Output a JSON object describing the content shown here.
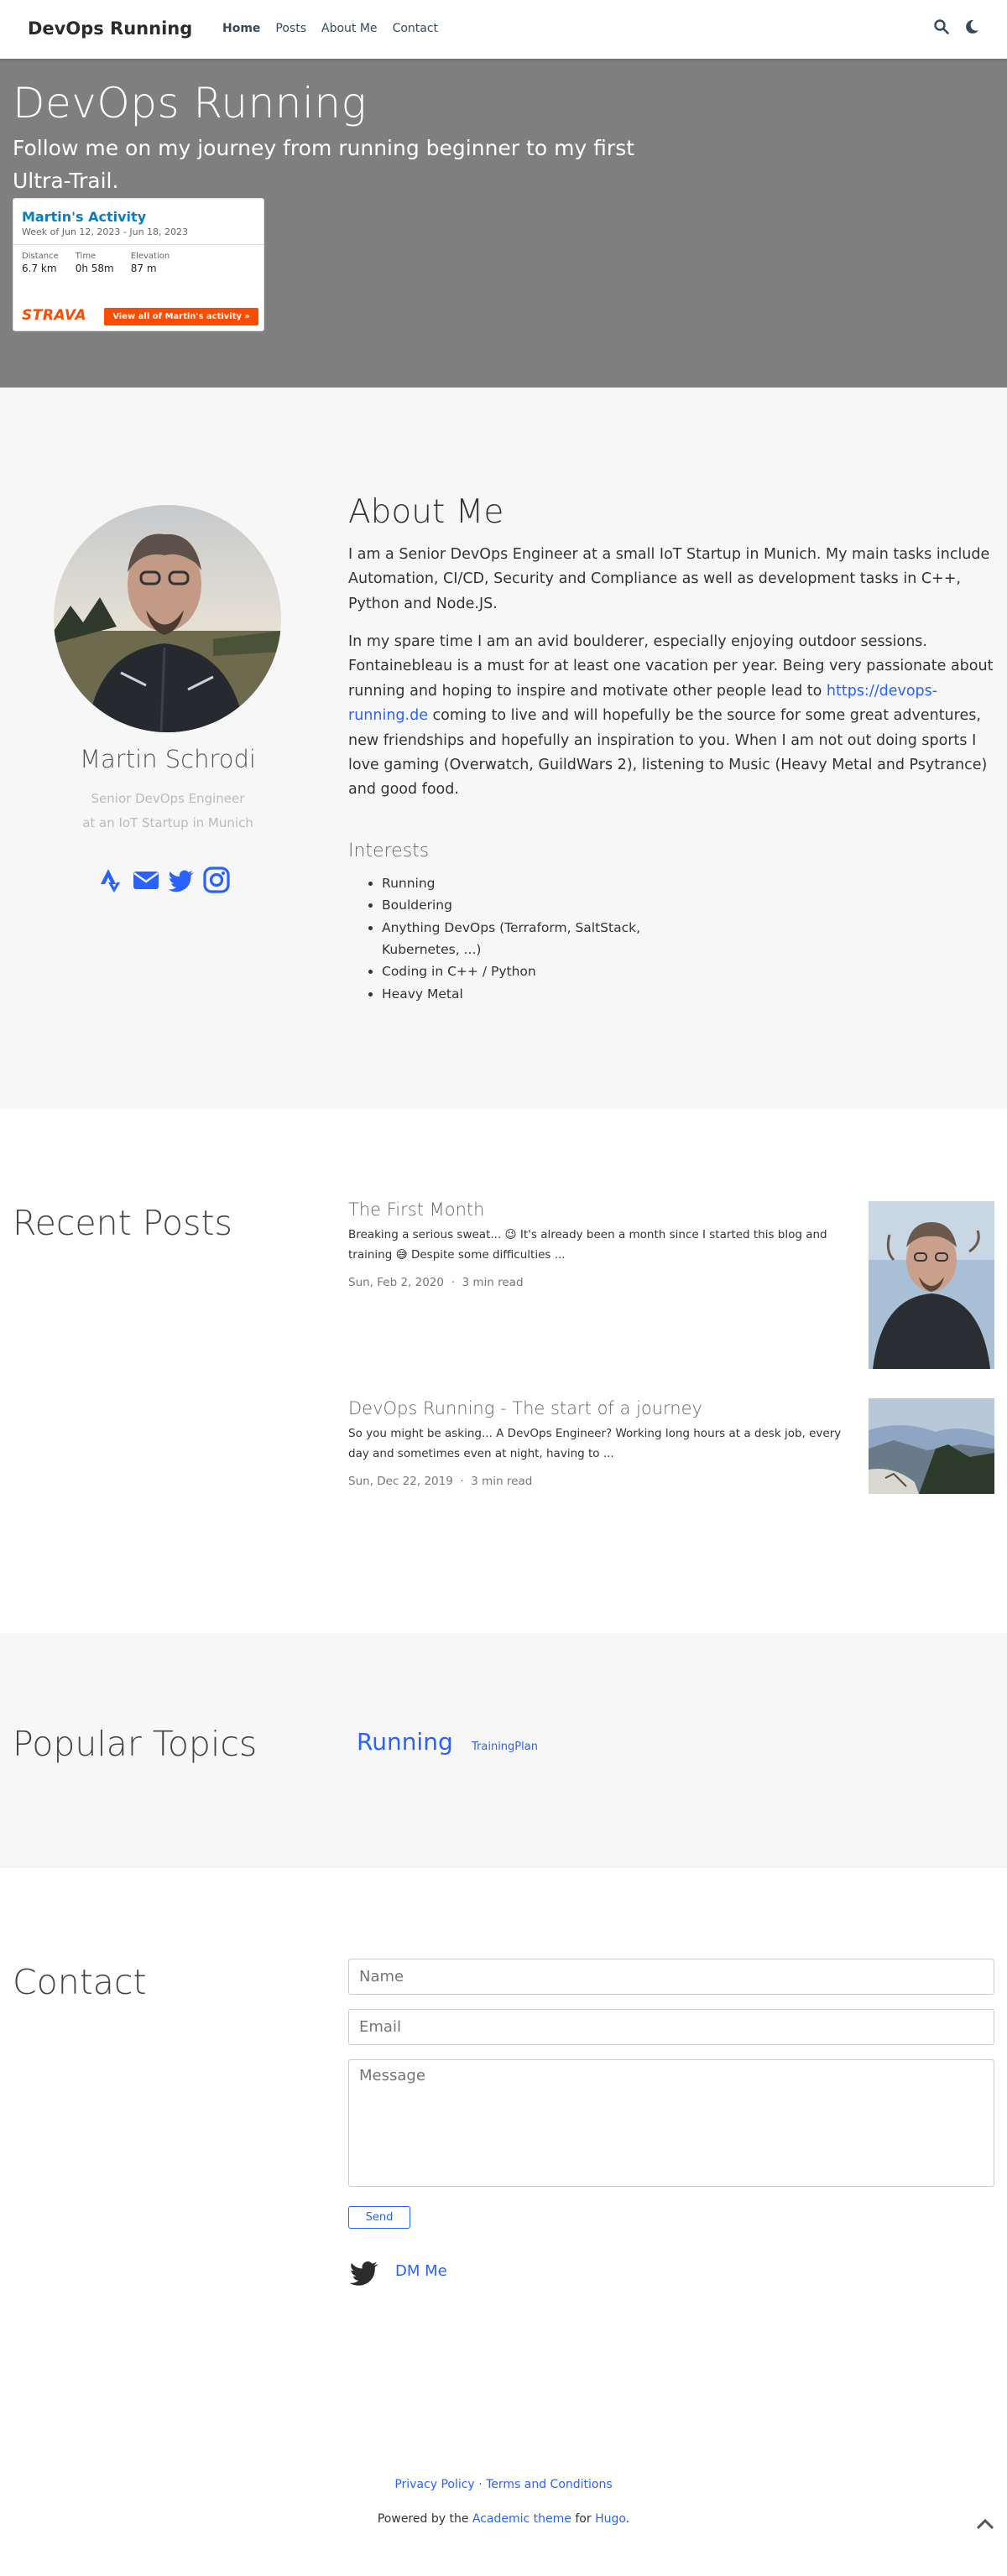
{
  "navbar": {
    "brand": "DevOps Running",
    "links": [
      "Home",
      "Posts",
      "About Me",
      "Contact"
    ],
    "active": "Home",
    "icons": [
      "search-icon",
      "moon-icon"
    ]
  },
  "hero": {
    "title": "DevOps Running",
    "lead": "Follow me on my journey from running beginner to my first Ultra-Trail.",
    "strava": {
      "title": "Martin's Activity",
      "week": "Week of Jun 12, 2023 - Jun 18, 2023",
      "stats": [
        {
          "label": "Distance",
          "value": "6.7 km"
        },
        {
          "label": "Time",
          "value": "0h 58m"
        },
        {
          "label": "Elevation",
          "value": "87 m"
        }
      ],
      "logo": "STRAVA",
      "button": "View all of Martin's activity »"
    }
  },
  "about": {
    "name": "Martin Schrodi",
    "role_line1": "Senior DevOps Engineer",
    "role_line2": "at an IoT Startup in Munich",
    "social_icons": [
      "strava-icon",
      "envelope-icon",
      "twitter-icon",
      "instagram-icon"
    ],
    "heading": "About Me",
    "p1": "I am a Senior DevOps Engineer at a small IoT Startup in Munich. My main tasks include Automation, CI/CD, Security and Compliance as well as development tasks in C++, Python and Node.JS.",
    "p2_before": "In my spare time I am an avid boulderer, especially enjoying outdoor sessions. Fontainebleau is a must for at least one vacation per year. Being very passionate about running and hoping to inspire and motivate other people lead to ",
    "p2_link": "https://devops-running.de",
    "p2_after": " coming to live and will hopefully be the source for some great adventures, new friendships and hopefully an inspiration to you. When I am not out doing sports I love gaming (Overwatch, GuildWars 2), listening to Music (Heavy Metal and Psytrance) and good food.",
    "interests_heading": "Interests",
    "interests": [
      "Running",
      "Bouldering",
      "Anything DevOps (Terraform, SaltStack, Kubernetes, ...)",
      "Coding in C++ / Python",
      "Heavy Metal"
    ]
  },
  "posts": {
    "heading": "Recent Posts",
    "items": [
      {
        "title": "The First Month",
        "summary": "Breaking a serious sweat... 😉 It's already been a month since I started this blog and training 😅 Despite some difficulties ...",
        "date": "Sun, Feb 2, 2020",
        "read": "3 min read"
      },
      {
        "title": "DevOps Running - The start of a journey",
        "summary": "So you might be asking... A DevOps Engineer? Working long hours at a desk job, every day and sometimes even at night, having to ...",
        "date": "Sun, Dec 22, 2019",
        "read": "3 min read"
      }
    ],
    "separator": "·"
  },
  "topics": {
    "heading": "Popular Topics",
    "tags": [
      "Running",
      "TrainingPlan"
    ]
  },
  "contact": {
    "heading": "Contact",
    "name_placeholder": "Name",
    "email_placeholder": "Email",
    "message_placeholder": "Message",
    "send": "Send",
    "dm": "DM Me"
  },
  "footer": {
    "privacy": "Privacy Policy",
    "sep": " · ",
    "terms": "Terms and Conditions",
    "powered_prefix": "Powered by the ",
    "theme": "Academic theme",
    "for": " for ",
    "hugo": "Hugo",
    "period": "."
  },
  "colors": {
    "accent": "#2962ff",
    "hero_bg": "#7f7f7f",
    "strava": "#fc4c02",
    "section_alt": "#f7f7f7"
  }
}
